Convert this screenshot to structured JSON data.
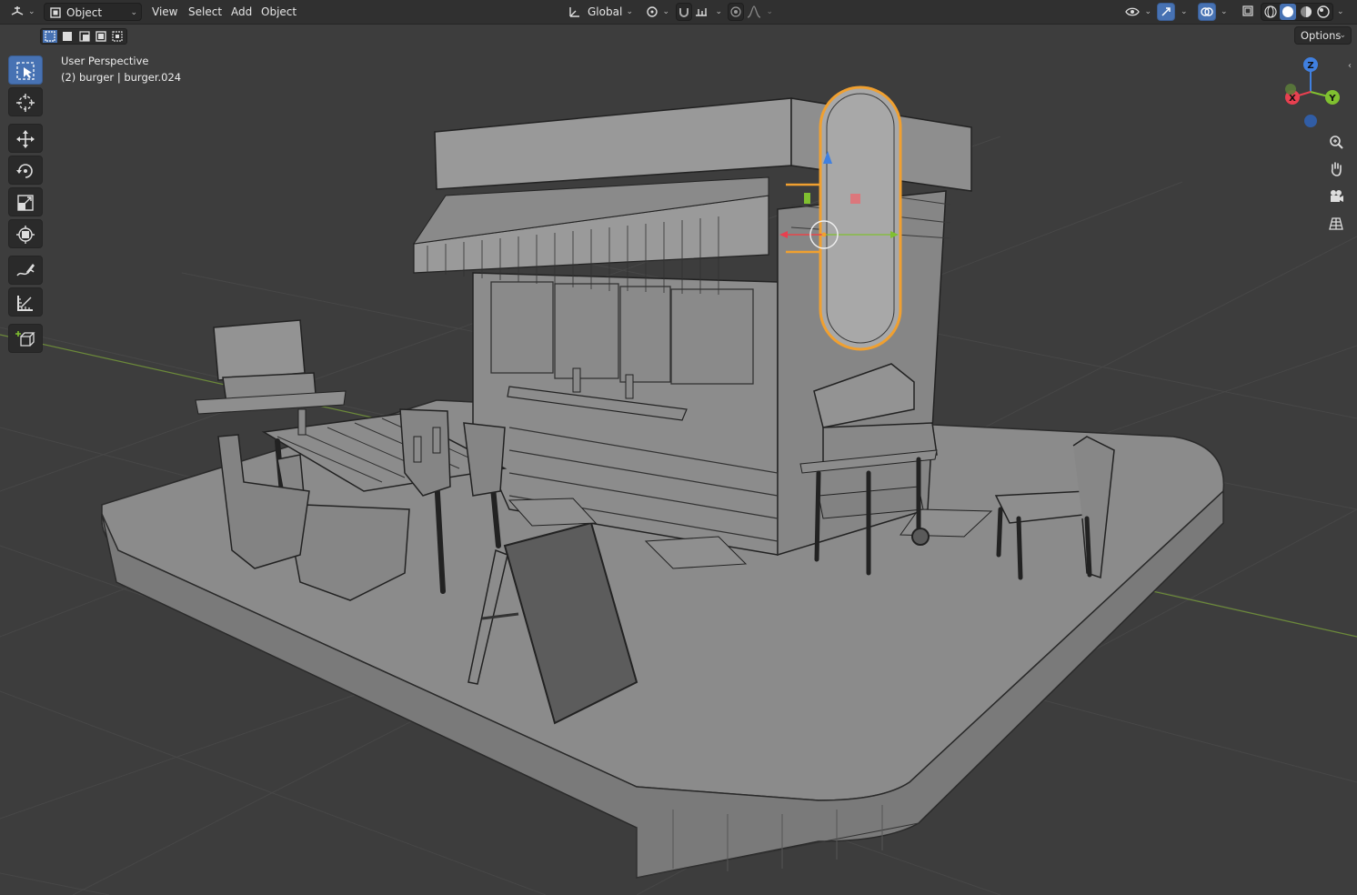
{
  "header": {
    "editor_type_icon": "3d-viewport-icon",
    "mode_label": "Object Mode",
    "menus": [
      "View",
      "Select",
      "Add",
      "Object"
    ],
    "orientation_label": "Global",
    "options_label": "Options"
  },
  "viewport": {
    "perspective_label": "User Perspective",
    "object_label": "(2) burger | burger.024"
  },
  "gizmo": {
    "x_label": "X",
    "y_label": "Y",
    "z_label": "Z"
  },
  "toolbar": {
    "tools": [
      "select-box-icon",
      "cursor-icon",
      "move-icon",
      "rotate-icon",
      "scale-icon",
      "transform-icon",
      "annotate-icon",
      "measure-icon",
      "add-cube-icon"
    ],
    "active_tool": "select-box-icon"
  },
  "colors": {
    "header_bg": "#303030",
    "viewport_bg": "#3d3d3d",
    "active_blue": "#4772b3",
    "selection_orange": "#f0a030",
    "axis_x": "#e84050",
    "axis_y": "#80c030",
    "axis_z": "#4080e0"
  }
}
